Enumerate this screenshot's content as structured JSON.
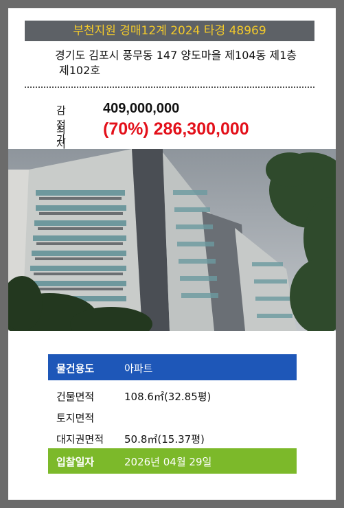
{
  "header": {
    "title": "부천지원 경매12계 2024 타경 48969"
  },
  "address": {
    "line1": "경기도 김포시 풍무동 147 양도마을 제104동 제1층",
    "line2": "제102호"
  },
  "prices": {
    "appraisal_label": "감정가",
    "appraisal_value": "409,000,000",
    "minimum_label": "최저가",
    "minimum_value": "(70%) 286,300,000"
  },
  "details": [
    {
      "key": "물건용도",
      "value": "아파트"
    },
    {
      "key": "건물면적",
      "value": "108.6㎡(32.85평)"
    },
    {
      "key": "토지면적",
      "value": ""
    },
    {
      "key": "대지권면적",
      "value": "50.8㎡(15.37평)"
    },
    {
      "key": "입찰일자",
      "value": "2026년 04월 29일"
    }
  ],
  "colors": {
    "title_bg": "#5d6166",
    "title_text": "#f2c92b",
    "min_price": "#e3101a",
    "detail_header": "#1e57b8",
    "detail_footer": "#7cb92a"
  }
}
